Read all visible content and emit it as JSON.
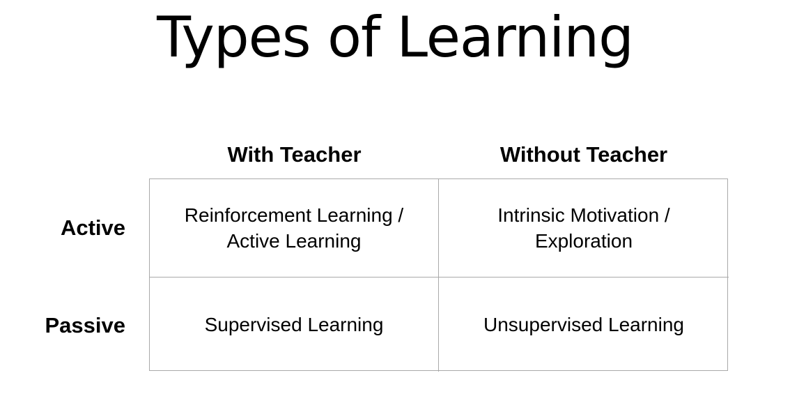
{
  "title": "Types of Learning",
  "columns": [
    "With Teacher",
    "Without Teacher"
  ],
  "rows": [
    "Active",
    "Passive"
  ],
  "cells": {
    "active_with_teacher": "Reinforcement Learning /\nActive Learning",
    "active_without_teacher": "Intrinsic Motivation /\nExploration",
    "passive_with_teacher": "Supervised Learning",
    "passive_without_teacher": "Unsupervised Learning"
  },
  "colors": {
    "border": "#a9a9a9",
    "text": "#000000",
    "background": "#ffffff"
  }
}
